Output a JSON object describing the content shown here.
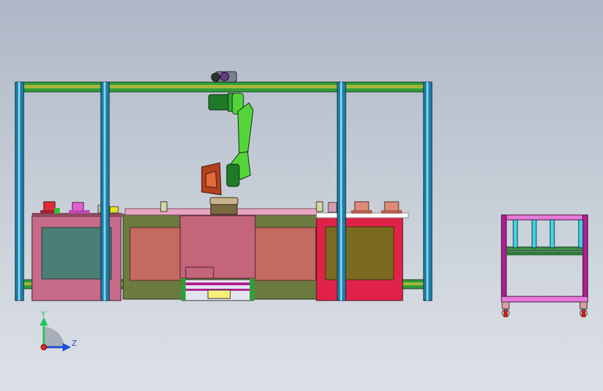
{
  "viewport": {
    "background_top": "#aeb7c6",
    "background_bottom": "#dde1e7"
  },
  "triad": {
    "y_label": "Y",
    "z_label": "Z",
    "y_color": "#22c55e",
    "z_color": "#1d4ed8",
    "origin_color": "#dc2626"
  },
  "colors": {
    "column_blue": "#1f7fa8",
    "beam_green": "#2f9e3a",
    "beam_yellow": "#a7b53a",
    "robot_green": "#55d43a",
    "robot_dark_green": "#1f7a28",
    "gripper_red": "#b3411f",
    "station_left": "#c76b8a",
    "station_left_panel": "#4b7e74",
    "station_center": "#c46a62",
    "station_center_frame": "#6b7a3f",
    "station_right_red": "#e0224a",
    "station_right_panel": "#7b6a1f",
    "pedestal_pink": "#c4657a",
    "cart_frame": "#b01e92",
    "cart_cyan": "#3fd6e6"
  }
}
